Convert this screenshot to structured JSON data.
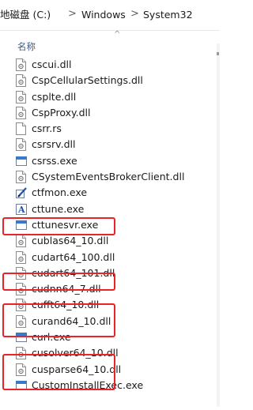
{
  "breadcrumb": {
    "drive": "地磁盘 (C:)",
    "sep": ">",
    "folder1": "Windows",
    "folder2": "System32"
  },
  "collapse_glyph": "^",
  "column": {
    "name_header": "名称"
  },
  "highlight_color": "#e8242b",
  "files": [
    {
      "name": "cscui.dll",
      "icon": "dll-file-icon"
    },
    {
      "name": "CspCellularSettings.dll",
      "icon": "dll-file-icon"
    },
    {
      "name": "csplte.dll",
      "icon": "dll-file-icon"
    },
    {
      "name": "CspProxy.dll",
      "icon": "dll-file-icon"
    },
    {
      "name": "csrr.rs",
      "icon": "generic-file-icon"
    },
    {
      "name": "csrsrv.dll",
      "icon": "dll-file-icon"
    },
    {
      "name": "csrss.exe",
      "icon": "exe-window-icon"
    },
    {
      "name": "CSystemEventsBrokerClient.dll",
      "icon": "dll-file-icon"
    },
    {
      "name": "ctfmon.exe",
      "icon": "ctfmon-pen-icon"
    },
    {
      "name": "cttune.exe",
      "icon": "cttune-font-icon"
    },
    {
      "name": "cttunesvr.exe",
      "icon": "exe-window-icon"
    },
    {
      "name": "cublas64_10.dll",
      "icon": "dll-file-icon"
    },
    {
      "name": "cudart64_100.dll",
      "icon": "dll-file-icon"
    },
    {
      "name": "cudart64_101.dll",
      "icon": "dll-file-icon"
    },
    {
      "name": "cudnn64_7.dll",
      "icon": "dll-file-icon"
    },
    {
      "name": "cufft64_10.dll",
      "icon": "dll-file-icon"
    },
    {
      "name": "curand64_10.dll",
      "icon": "dll-file-icon"
    },
    {
      "name": "curl.exe",
      "icon": "exe-window-icon"
    },
    {
      "name": "cusolver64_10.dll",
      "icon": "dll-file-icon"
    },
    {
      "name": "cusparse64_10.dll",
      "icon": "dll-file-icon"
    },
    {
      "name": "CustomInstallExec.exe",
      "icon": "exe-window-icon"
    }
  ]
}
